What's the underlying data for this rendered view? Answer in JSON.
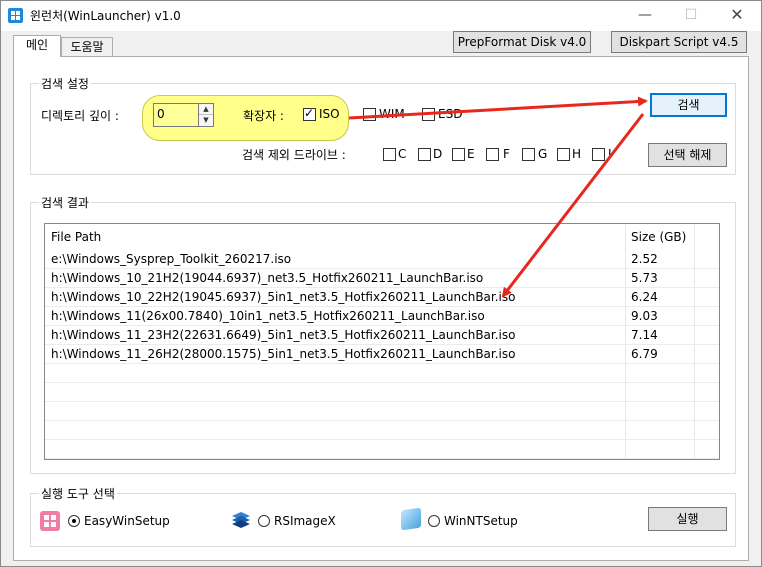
{
  "window": {
    "title": "윈런처(WinLauncher) v1.0",
    "min_glyph": "—",
    "max_glyph": "☐",
    "close_glyph": "✕"
  },
  "tabs": [
    {
      "label": "메인",
      "active": true
    },
    {
      "label": "도움말",
      "active": false
    }
  ],
  "top_buttons": {
    "prepformat": "PrepFormat Disk v4.0",
    "diskpart": "Diskpart Script v4.5"
  },
  "search_settings": {
    "group_title": "검색 설정",
    "depth_label": "디렉토리 깊이 :",
    "depth_value": "0",
    "ext_label": "확장자 :",
    "extensions": [
      {
        "label": "ISO",
        "checked": true
      },
      {
        "label": "WIM",
        "checked": false
      },
      {
        "label": "ESD",
        "checked": false
      }
    ],
    "search_button": "검색",
    "exclude_label": "검색 제외 드라이브 :",
    "drives": [
      "C",
      "D",
      "E",
      "F",
      "G",
      "H",
      "I"
    ],
    "deselect_button": "선택 해제"
  },
  "results": {
    "group_title": "검색 결과",
    "columns": [
      "File Path",
      "Size (GB)"
    ],
    "rows": [
      {
        "path": "e:\\Windows_Sysprep_Toolkit_260217.iso",
        "size": "2.52"
      },
      {
        "path": "h:\\Windows_10_21H2(19044.6937)_net3.5_Hotfix260211_LaunchBar.iso",
        "size": "5.73"
      },
      {
        "path": "h:\\Windows_10_22H2(19045.6937)_5in1_net3.5_Hotfix260211_LaunchBar.iso",
        "size": "6.24"
      },
      {
        "path": "h:\\Windows_11(26x00.7840)_10in1_net3.5_Hotfix260211_LaunchBar.iso",
        "size": "9.03"
      },
      {
        "path": "h:\\Windows_11_23H2(22631.6649)_5in1_net3.5_Hotfix260211_LaunchBar.iso",
        "size": "7.14"
      },
      {
        "path": "h:\\Windows_11_26H2(28000.1575)_5in1_net3.5_Hotfix260211_LaunchBar.iso",
        "size": "6.79"
      }
    ]
  },
  "tools": {
    "group_title": "실행 도구 선택",
    "options": [
      {
        "label": "EasyWinSetup",
        "icon": "easywinsetup-icon",
        "selected": true
      },
      {
        "label": "RSImageX",
        "icon": "rsimagex-icon",
        "selected": false
      },
      {
        "label": "WinNTSetup",
        "icon": "winntsetup-icon",
        "selected": false
      }
    ],
    "run_button": "실행"
  },
  "colors": {
    "highlight": "#ffff8a",
    "arrow": "#e8281f",
    "focus_border": "#0078d7"
  },
  "annotations": {
    "arrows": [
      "iso-checkbox-to-search-button",
      "search-button-to-results"
    ]
  }
}
